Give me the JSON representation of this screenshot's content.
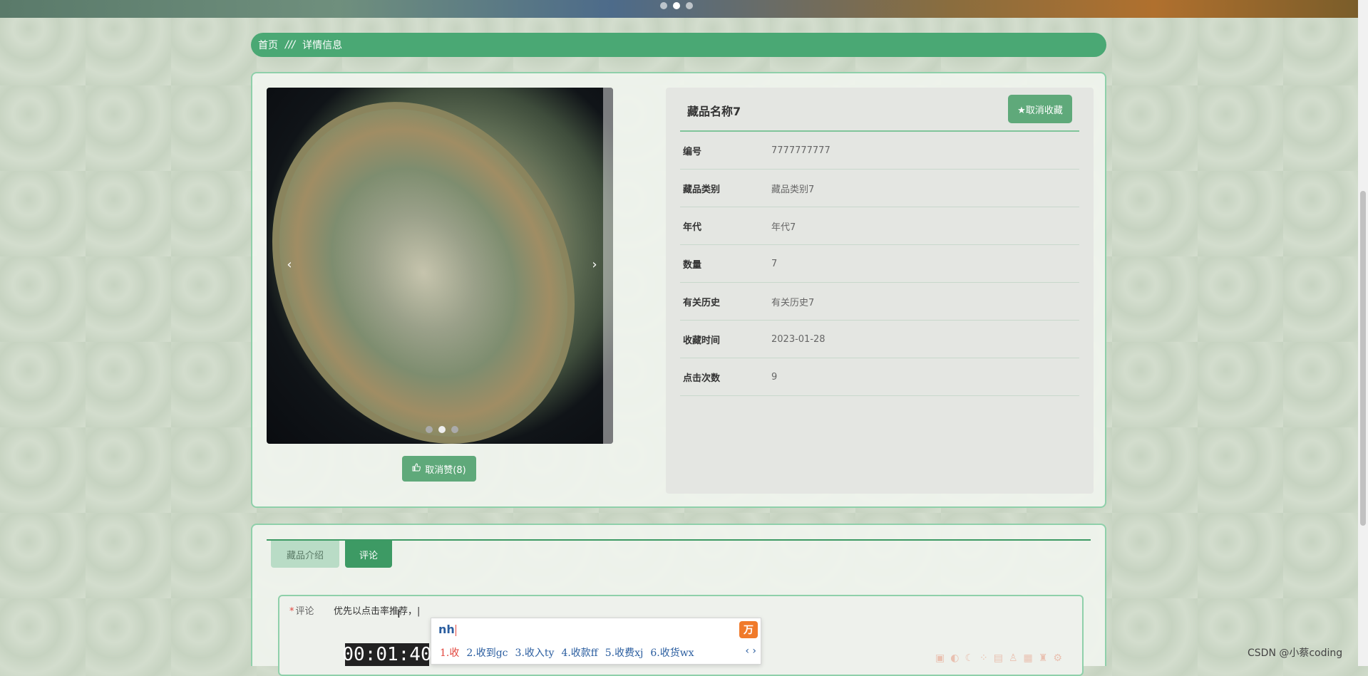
{
  "banner": {
    "dots": [
      "",
      "",
      ""
    ]
  },
  "breadcrumb": {
    "home": "首页",
    "separator": "///",
    "current": "详情信息"
  },
  "carousel": {
    "prev": "‹",
    "next": "›"
  },
  "like_button": {
    "label": "取消赞(8)"
  },
  "detail": {
    "title": "藏品名称7",
    "favorite_label": "★取消收藏",
    "rows": [
      {
        "key": "编号",
        "value": "7777777777"
      },
      {
        "key": "藏品类别",
        "value": "藏品类别7"
      },
      {
        "key": "年代",
        "value": "年代7"
      },
      {
        "key": "数量",
        "value": "7"
      },
      {
        "key": "有关历史",
        "value": "有关历史7"
      },
      {
        "key": "收藏时间",
        "value": "2023-01-28"
      },
      {
        "key": "点击次数",
        "value": "9"
      }
    ]
  },
  "tabs": [
    {
      "label": "藏品介绍"
    },
    {
      "label": "评论"
    }
  ],
  "comment_form": {
    "required_mark": "*",
    "label": "评论",
    "value": "优先以点击率推荐，|"
  },
  "timer": "00:01:40",
  "ime": {
    "input": "nh",
    "logo": "万",
    "candidates": [
      "1.收",
      "2.收到gc",
      "3.收入ty",
      "4.收款ff",
      "5.收费xj",
      "6.收货wx"
    ],
    "pager": "‹ ›"
  },
  "watermark": "CSDN @小蔡coding"
}
